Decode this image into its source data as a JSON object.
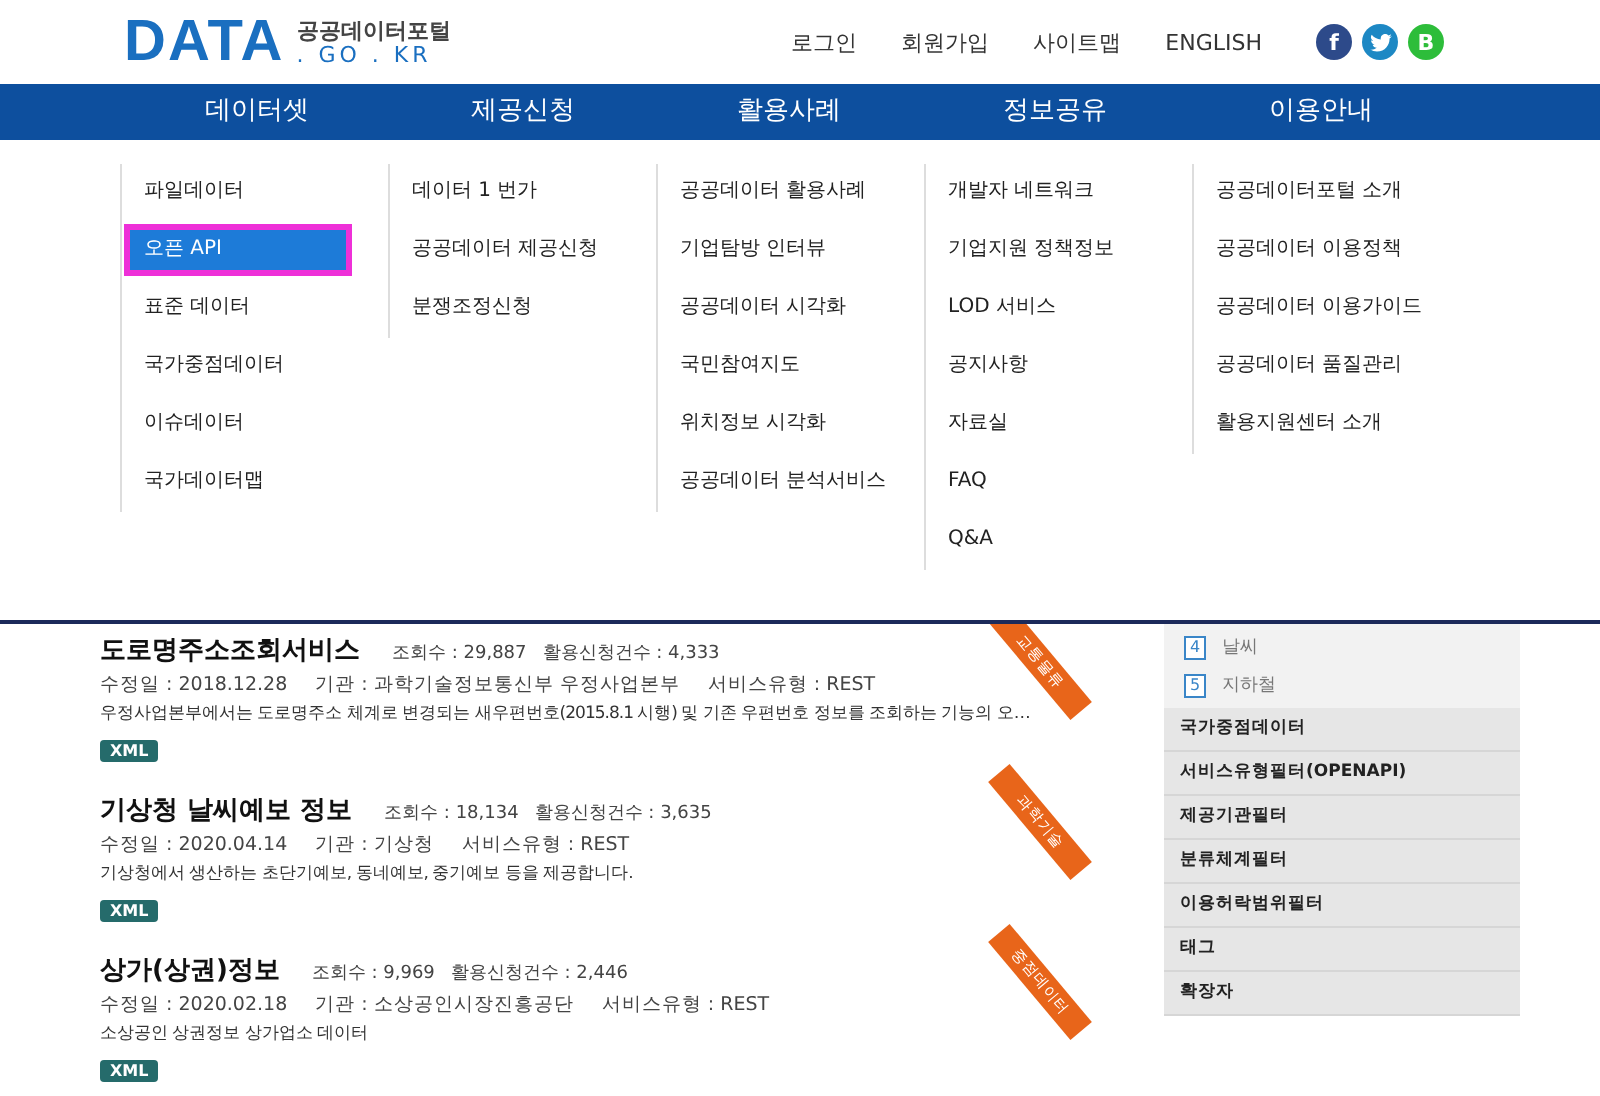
{
  "header": {
    "logo": {
      "wordmark": "DATA",
      "subtitle": "공공데이터포털",
      "domain": ". GO . KR"
    },
    "links": [
      "로그인",
      "회원가입",
      "사이트맵",
      "ENGLISH"
    ],
    "social": [
      {
        "kind": "facebook",
        "glyph": "f",
        "color": "#2d4a8a"
      },
      {
        "kind": "twitter",
        "color": "#1d88c4"
      },
      {
        "kind": "blog",
        "glyph": "B",
        "color": "#2dbd3a"
      }
    ]
  },
  "nav": {
    "items": [
      "데이터셋",
      "제공신청",
      "활용사례",
      "정보공유",
      "이용안내"
    ]
  },
  "mega_menu": {
    "columns": [
      [
        {
          "label": "파일데이터",
          "selected": false
        },
        {
          "label": "오픈 API",
          "selected": true
        },
        {
          "label": "표준 데이터",
          "selected": false
        },
        {
          "label": "국가중점데이터",
          "selected": false
        },
        {
          "label": "이슈데이터",
          "selected": false
        },
        {
          "label": "국가데이터맵",
          "selected": false
        }
      ],
      [
        {
          "label": "데이터 1 번가",
          "selected": false
        },
        {
          "label": "공공데이터 제공신청",
          "selected": false
        },
        {
          "label": "분쟁조정신청",
          "selected": false
        }
      ],
      [
        {
          "label": "공공데이터 활용사례",
          "selected": false
        },
        {
          "label": "기업탐방 인터뷰",
          "selected": false
        },
        {
          "label": "공공데이터 시각화",
          "selected": false
        },
        {
          "label": "국민참여지도",
          "selected": false
        },
        {
          "label": "위치정보 시각화",
          "selected": false
        },
        {
          "label": "공공데이터 분석서비스",
          "selected": false
        }
      ],
      [
        {
          "label": "개발자 네트워크",
          "selected": false
        },
        {
          "label": "기업지원 정책정보",
          "selected": false
        },
        {
          "label": "LOD 서비스",
          "selected": false
        },
        {
          "label": "공지사항",
          "selected": false
        },
        {
          "label": "자료실",
          "selected": false
        },
        {
          "label": "FAQ",
          "selected": false
        },
        {
          "label": "Q&A",
          "selected": false
        }
      ],
      [
        {
          "label": "공공데이터포털 소개",
          "selected": false
        },
        {
          "label": "공공데이터 이용정책",
          "selected": false
        },
        {
          "label": "공공데이터 이용가이드",
          "selected": false
        },
        {
          "label": "공공데이터 품질관리",
          "selected": false
        },
        {
          "label": "활용지원센터 소개",
          "selected": false
        }
      ]
    ]
  },
  "results": [
    {
      "title": "도로명주소조회서비스",
      "views": "조회수 : 29,887",
      "applications": "활용신청건수 : 4,333",
      "modified": "수정일 : 2018.12.28",
      "agency": "기관 : 과학기술정보통신부 우정사업본부",
      "service_type": "서비스유형 : REST",
      "description": "우정사업본부에서는 도로명주소 체계로 변경되는 새우편번호(2015.8.1 시행) 및 기존 우편번호 정보를 조회하는 기능의 오…",
      "format": "XML",
      "ribbon": "교통물류"
    },
    {
      "title": "기상청 날씨예보 정보",
      "views": "조회수 : 18,134",
      "applications": "활용신청건수 : 3,635",
      "modified": "수정일 : 2020.04.14",
      "agency": "기관 : 기상청",
      "service_type": "서비스유형 : REST",
      "description": "기상청에서 생산하는 초단기예보, 동네예보, 중기예보 등을 제공합니다.",
      "format": "XML",
      "ribbon": "과학기술"
    },
    {
      "title": "상가(상권)정보",
      "views": "조회수 : 9,969",
      "applications": "활용신청건수 : 2,446",
      "modified": "수정일 : 2020.02.18",
      "agency": "기관 : 소상공인시장진흥공단",
      "service_type": "서비스유형 : REST",
      "description": "소상공인 상권정보 상가업소 데이터",
      "format": "XML",
      "ribbon": "중점데이터"
    }
  ],
  "sidebar": {
    "ranked": [
      {
        "rank": "4",
        "label": "날씨"
      },
      {
        "rank": "5",
        "label": "지하철"
      }
    ],
    "filters": [
      "국가중점데이터",
      "서비스유형필터(OPENAPI)",
      "제공기관필터",
      "분류체계필터",
      "이용허락범위필터",
      "태그",
      "확장자"
    ]
  }
}
